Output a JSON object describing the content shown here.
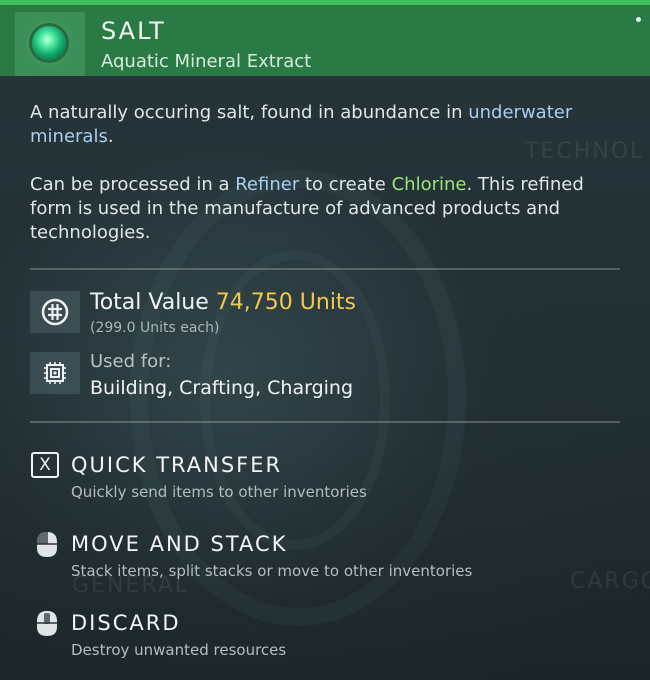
{
  "header": {
    "title": "SALT",
    "subtitle": "Aquatic Mineral Extract",
    "item_icon": "green-orb-icon",
    "colors": {
      "header_bg": "#2a7a45",
      "accent": "#3fbf60"
    }
  },
  "description": {
    "p1_text": "A naturally occuring salt, found in abundance in ",
    "p1_link": "underwater minerals",
    "p1_end": ".",
    "p2_start": "Can be processed in a ",
    "p2_link1": "Refiner",
    "p2_mid": " to create ",
    "p2_link2": "Chlorine",
    "p2_end": ". This refined form is used in the manufacture of advanced products and technologies.",
    "colors": {
      "link_blue": "#a9cdf0",
      "link_green": "#9ce679"
    }
  },
  "stats": {
    "total_value_label": "Total Value",
    "total_value_amount": "74,750 Units",
    "each_value": "(299.0 Units each)",
    "used_for_label": "Used for:",
    "used_for_value": "Building, Crafting, Charging",
    "value_icon": "units-currency-icon",
    "used_icon": "chip-icon",
    "colors": {
      "value_amount": "#f2c94c"
    }
  },
  "actions": [
    {
      "key": "X",
      "title": "QUICK TRANSFER",
      "desc": "Quickly send items to other inventories",
      "icon": "keyboard-x-icon"
    },
    {
      "title": "MOVE AND STACK",
      "desc": "Stack items, split stacks or move to other inventories",
      "icon": "mouse-left-click-icon"
    },
    {
      "title": "DISCARD",
      "desc": "Destroy unwanted resources",
      "icon": "mouse-middle-click-icon"
    }
  ],
  "background": {
    "text_1": "TECHNOL",
    "text_2": "GENERAL",
    "text_3": "CARGO"
  }
}
